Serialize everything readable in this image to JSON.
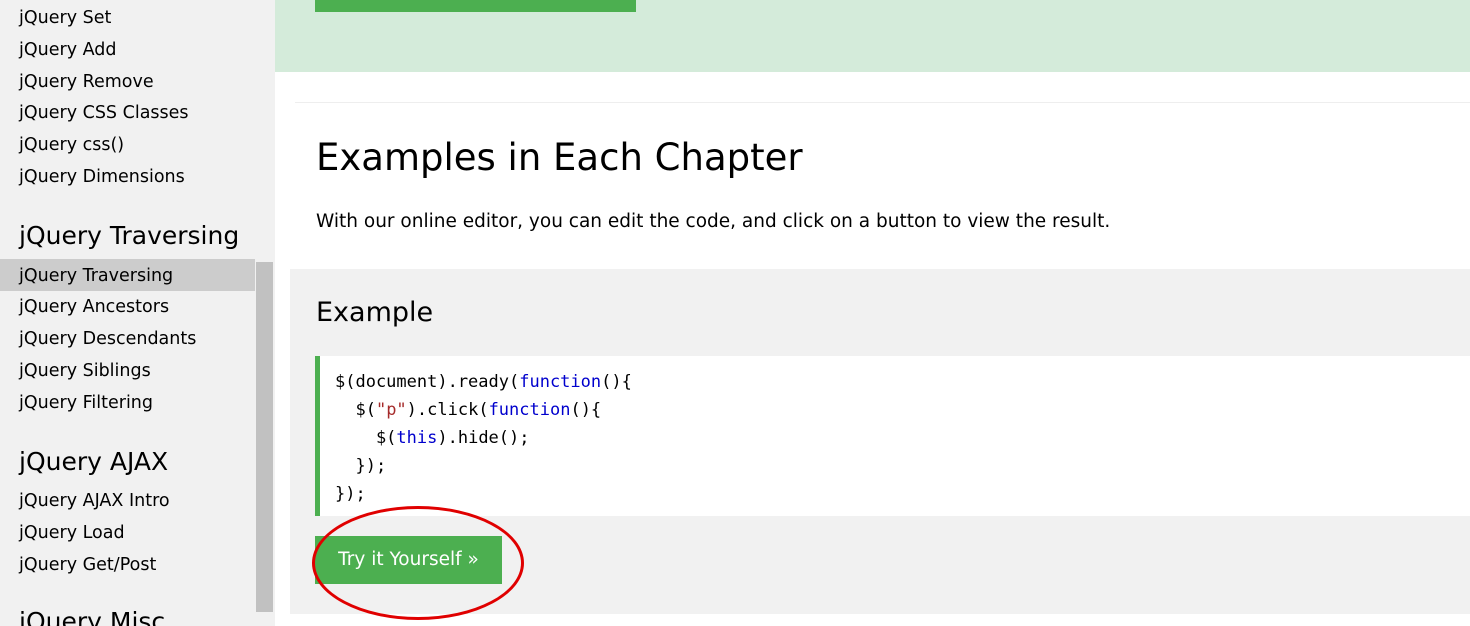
{
  "sidebar": {
    "links_top": [
      {
        "label": "jQuery Set"
      },
      {
        "label": "jQuery Add"
      },
      {
        "label": "jQuery Remove"
      },
      {
        "label": "jQuery CSS Classes"
      },
      {
        "label": "jQuery css()"
      },
      {
        "label": "jQuery Dimensions"
      }
    ],
    "traversing": {
      "heading": "jQuery Traversing",
      "items": [
        {
          "label": "jQuery Traversing"
        },
        {
          "label": "jQuery Ancestors"
        },
        {
          "label": "jQuery Descendants"
        },
        {
          "label": "jQuery Siblings"
        },
        {
          "label": "jQuery Filtering"
        }
      ]
    },
    "ajax": {
      "heading": "jQuery AJAX",
      "items": [
        {
          "label": "jQuery AJAX Intro"
        },
        {
          "label": "jQuery Load"
        },
        {
          "label": "jQuery Get/Post"
        }
      ]
    },
    "misc": {
      "heading": "jQuery Misc"
    }
  },
  "main": {
    "section_title": "Examples in Each Chapter",
    "intro": "With our online editor, you can edit the code, and click on a button to view the result.",
    "example": {
      "title": "Example",
      "try_button": "Try it Yourself »"
    }
  },
  "colors": {
    "accent_green": "#4caf50",
    "banner_green": "#d4ebda",
    "annotation_red": "#e00000"
  }
}
